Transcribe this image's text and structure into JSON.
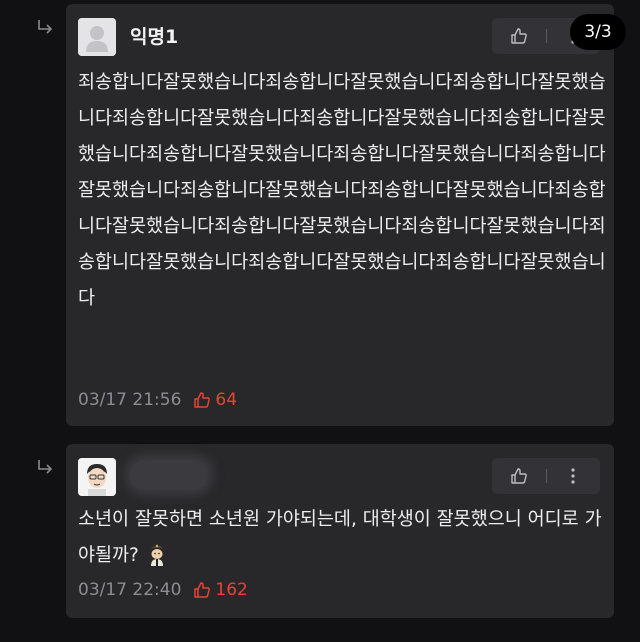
{
  "pager": {
    "text": "3/3"
  },
  "comments": [
    {
      "author": "익명1",
      "text": "죄송합니다잘못했습니다죄송합니다잘못했습니다죄송합니다잘못했습니다죄송합니다잘못했습니다죄송합니다잘못했습니다죄송합니다잘못했습니다죄송합니다잘못했습니다죄송합니다잘못했습니다죄송합니다잘못했습니다죄송합니다잘못했습니다죄송합니다잘못했습니다죄송합니다잘못했습니다죄송합니다잘못했습니다죄송합니다잘못했습니다죄송합니다잘못했습니다죄송합니다잘못했습니다죄송합니다잘못했습니다",
      "date": "03/17 21:56",
      "likes": "64"
    },
    {
      "author": "",
      "text": "소년이 잘못하면 소년원 가야되는데, 대학생이 잘못했으니 어디로 가야될까?",
      "date": "03/17 22:40",
      "likes": "162"
    }
  ],
  "colors": {
    "like": "#e8442f",
    "card": "#28282b",
    "background": "#111113"
  },
  "icons": [
    "reply-arrow-icon",
    "default-avatar-icon",
    "thumbs-up-icon",
    "more-vertical-icon",
    "soldier-emoji-icon"
  ]
}
